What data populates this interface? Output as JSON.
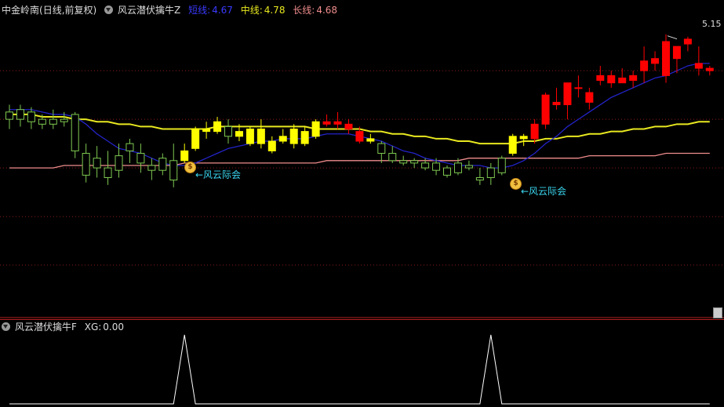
{
  "header": {
    "stock_name": "中金岭南",
    "period_label": "(日线,前复权)",
    "indicator_name": "风云潜伏擒牛Z",
    "short_label": "短线:",
    "short_value": "4.67",
    "mid_label": "中线:",
    "mid_value": "4.78",
    "long_label": "长线:",
    "long_value": "4.68"
  },
  "sub_header": {
    "indicator_name": "风云潜伏擒牛F",
    "xg_label": "XG:",
    "xg_value": "0.00"
  },
  "annotations": [
    {
      "text": "←风云际会",
      "bar": 16
    },
    {
      "text": "←风云际会",
      "bar": 44
    }
  ],
  "max_label": "5.15",
  "colors": {
    "background": "#000000",
    "up_candle": "#ff0000",
    "down_candle": "#7ec850",
    "signal_candle": "#ffff00",
    "short_line": "#2323c8",
    "mid_line": "#e8e820",
    "long_line": "#f08c8c",
    "grid": "#8b1a1a",
    "annotation": "#3ad6f0"
  },
  "chart_data": {
    "type": "candlestick",
    "price_range": [
      4.0,
      5.22
    ],
    "candles": [
      {
        "o": 4.83,
        "h": 4.86,
        "l": 4.76,
        "c": 4.8,
        "k": "down"
      },
      {
        "o": 4.84,
        "h": 4.86,
        "l": 4.77,
        "c": 4.8,
        "k": "down"
      },
      {
        "o": 4.83,
        "h": 4.85,
        "l": 4.76,
        "c": 4.79,
        "k": "down"
      },
      {
        "o": 4.8,
        "h": 4.82,
        "l": 4.76,
        "c": 4.78,
        "k": "down"
      },
      {
        "o": 4.8,
        "h": 4.84,
        "l": 4.76,
        "c": 4.78,
        "k": "down"
      },
      {
        "o": 4.8,
        "h": 4.83,
        "l": 4.77,
        "c": 4.79,
        "k": "down"
      },
      {
        "o": 4.82,
        "h": 4.83,
        "l": 4.64,
        "c": 4.67,
        "k": "down"
      },
      {
        "o": 4.66,
        "h": 4.7,
        "l": 4.54,
        "c": 4.57,
        "k": "down"
      },
      {
        "o": 4.64,
        "h": 4.69,
        "l": 4.56,
        "c": 4.6,
        "k": "down"
      },
      {
        "o": 4.6,
        "h": 4.67,
        "l": 4.53,
        "c": 4.56,
        "k": "down"
      },
      {
        "o": 4.65,
        "h": 4.7,
        "l": 4.56,
        "c": 4.59,
        "k": "down"
      },
      {
        "o": 4.7,
        "h": 4.72,
        "l": 4.62,
        "c": 4.67,
        "k": "down"
      },
      {
        "o": 4.66,
        "h": 4.7,
        "l": 4.58,
        "c": 4.62,
        "k": "down"
      },
      {
        "o": 4.61,
        "h": 4.64,
        "l": 4.55,
        "c": 4.59,
        "k": "down"
      },
      {
        "o": 4.64,
        "h": 4.66,
        "l": 4.57,
        "c": 4.59,
        "k": "down"
      },
      {
        "o": 4.63,
        "h": 4.7,
        "l": 4.52,
        "c": 4.55,
        "k": "down"
      },
      {
        "o": 4.63,
        "h": 4.7,
        "l": 4.62,
        "c": 4.67,
        "k": "signal"
      },
      {
        "o": 4.68,
        "h": 4.77,
        "l": 4.67,
        "c": 4.76,
        "k": "signal"
      },
      {
        "o": 4.75,
        "h": 4.79,
        "l": 4.72,
        "c": 4.76,
        "k": "signal"
      },
      {
        "o": 4.75,
        "h": 4.81,
        "l": 4.74,
        "c": 4.79,
        "k": "signal"
      },
      {
        "o": 4.77,
        "h": 4.8,
        "l": 4.7,
        "c": 4.73,
        "k": "down"
      },
      {
        "o": 4.75,
        "h": 4.78,
        "l": 4.71,
        "c": 4.73,
        "k": "signal"
      },
      {
        "o": 4.7,
        "h": 4.77,
        "l": 4.69,
        "c": 4.76,
        "k": "signal"
      },
      {
        "o": 4.76,
        "h": 4.8,
        "l": 4.68,
        "c": 4.7,
        "k": "signal"
      },
      {
        "o": 4.67,
        "h": 4.73,
        "l": 4.66,
        "c": 4.71,
        "k": "signal"
      },
      {
        "o": 4.71,
        "h": 4.76,
        "l": 4.7,
        "c": 4.73,
        "k": "signal"
      },
      {
        "o": 4.7,
        "h": 4.78,
        "l": 4.68,
        "c": 4.76,
        "k": "signal"
      },
      {
        "o": 4.7,
        "h": 4.77,
        "l": 4.69,
        "c": 4.75,
        "k": "signal"
      },
      {
        "o": 4.73,
        "h": 4.8,
        "l": 4.72,
        "c": 4.79,
        "k": "signal"
      },
      {
        "o": 4.78,
        "h": 4.82,
        "l": 4.77,
        "c": 4.79,
        "k": "up"
      },
      {
        "o": 4.79,
        "h": 4.83,
        "l": 4.76,
        "c": 4.78,
        "k": "up"
      },
      {
        "o": 4.78,
        "h": 4.8,
        "l": 4.74,
        "c": 4.76,
        "k": "up"
      },
      {
        "o": 4.75,
        "h": 4.77,
        "l": 4.7,
        "c": 4.71,
        "k": "up"
      },
      {
        "o": 4.72,
        "h": 4.74,
        "l": 4.7,
        "c": 4.71,
        "k": "signal"
      },
      {
        "o": 4.7,
        "h": 4.71,
        "l": 4.62,
        "c": 4.66,
        "k": "down"
      },
      {
        "o": 4.66,
        "h": 4.69,
        "l": 4.62,
        "c": 4.63,
        "k": "down"
      },
      {
        "o": 4.63,
        "h": 4.65,
        "l": 4.61,
        "c": 4.62,
        "k": "down"
      },
      {
        "o": 4.62,
        "h": 4.64,
        "l": 4.6,
        "c": 4.63,
        "k": "down"
      },
      {
        "o": 4.62,
        "h": 4.64,
        "l": 4.59,
        "c": 4.6,
        "k": "down"
      },
      {
        "o": 4.62,
        "h": 4.64,
        "l": 4.57,
        "c": 4.59,
        "k": "down"
      },
      {
        "o": 4.6,
        "h": 4.61,
        "l": 4.56,
        "c": 4.57,
        "k": "down"
      },
      {
        "o": 4.62,
        "h": 4.64,
        "l": 4.57,
        "c": 4.58,
        "k": "down"
      },
      {
        "o": 4.61,
        "h": 4.63,
        "l": 4.59,
        "c": 4.6,
        "k": "down"
      },
      {
        "o": 4.56,
        "h": 4.6,
        "l": 4.53,
        "c": 4.55,
        "k": "down"
      },
      {
        "o": 4.6,
        "h": 4.62,
        "l": 4.53,
        "c": 4.56,
        "k": "down"
      },
      {
        "o": 4.64,
        "h": 4.65,
        "l": 4.57,
        "c": 4.58,
        "k": "down"
      },
      {
        "o": 4.66,
        "h": 4.74,
        "l": 4.65,
        "c": 4.73,
        "k": "signal"
      },
      {
        "o": 4.73,
        "h": 4.74,
        "l": 4.69,
        "c": 4.72,
        "k": "signal"
      },
      {
        "o": 4.72,
        "h": 4.8,
        "l": 4.7,
        "c": 4.78,
        "k": "up"
      },
      {
        "o": 4.78,
        "h": 4.91,
        "l": 4.76,
        "c": 4.9,
        "k": "up"
      },
      {
        "o": 4.86,
        "h": 4.93,
        "l": 4.84,
        "c": 4.87,
        "k": "up"
      },
      {
        "o": 4.86,
        "h": 4.95,
        "l": 4.8,
        "c": 4.95,
        "k": "up"
      },
      {
        "o": 4.93,
        "h": 4.98,
        "l": 4.89,
        "c": 4.93,
        "k": "up"
      },
      {
        "o": 4.87,
        "h": 4.93,
        "l": 4.84,
        "c": 4.91,
        "k": "up"
      },
      {
        "o": 4.96,
        "h": 5.02,
        "l": 4.94,
        "c": 4.98,
        "k": "up"
      },
      {
        "o": 4.98,
        "h": 5.0,
        "l": 4.93,
        "c": 4.95,
        "k": "up"
      },
      {
        "o": 4.97,
        "h": 5.01,
        "l": 4.95,
        "c": 4.95,
        "k": "up"
      },
      {
        "o": 4.96,
        "h": 5.0,
        "l": 4.93,
        "c": 4.98,
        "k": "up"
      },
      {
        "o": 5.0,
        "h": 5.1,
        "l": 4.95,
        "c": 5.04,
        "k": "up"
      },
      {
        "o": 5.03,
        "h": 5.08,
        "l": 5.0,
        "c": 5.05,
        "k": "up"
      },
      {
        "o": 4.98,
        "h": 5.15,
        "l": 4.95,
        "c": 5.12,
        "k": "up"
      },
      {
        "o": 5.05,
        "h": 5.1,
        "l": 4.99,
        "c": 5.1,
        "k": "up"
      },
      {
        "o": 5.11,
        "h": 5.14,
        "l": 5.08,
        "c": 5.13,
        "k": "up"
      },
      {
        "o": 5.03,
        "h": 5.1,
        "l": 4.98,
        "c": 5.01,
        "k": "up"
      },
      {
        "o": 5.01,
        "h": 5.02,
        "l": 4.98,
        "c": 5.0,
        "k": "up"
      }
    ],
    "short_line": [
      4.84,
      4.84,
      4.84,
      4.83,
      4.82,
      4.82,
      4.81,
      4.78,
      4.74,
      4.71,
      4.68,
      4.67,
      4.66,
      4.64,
      4.62,
      4.61,
      4.61,
      4.62,
      4.64,
      4.66,
      4.68,
      4.69,
      4.7,
      4.71,
      4.71,
      4.72,
      4.72,
      4.72,
      4.73,
      4.74,
      4.74,
      4.74,
      4.73,
      4.72,
      4.71,
      4.69,
      4.67,
      4.66,
      4.64,
      4.63,
      4.62,
      4.61,
      4.61,
      4.61,
      4.6,
      4.6,
      4.61,
      4.63,
      4.66,
      4.7,
      4.73,
      4.77,
      4.8,
      4.83,
      4.86,
      4.89,
      4.91,
      4.93,
      4.95,
      4.97,
      4.98,
      5.0,
      5.02,
      5.03,
      5.03
    ],
    "mid_line": [
      4.82,
      4.82,
      4.82,
      4.81,
      4.81,
      4.81,
      4.8,
      4.8,
      4.79,
      4.79,
      4.78,
      4.78,
      4.77,
      4.77,
      4.76,
      4.76,
      4.76,
      4.76,
      4.76,
      4.77,
      4.77,
      4.77,
      4.77,
      4.77,
      4.77,
      4.77,
      4.77,
      4.77,
      4.76,
      4.76,
      4.76,
      4.76,
      4.76,
      4.75,
      4.75,
      4.74,
      4.74,
      4.73,
      4.73,
      4.72,
      4.72,
      4.71,
      4.71,
      4.7,
      4.7,
      4.7,
      4.7,
      4.71,
      4.71,
      4.72,
      4.72,
      4.73,
      4.73,
      4.74,
      4.74,
      4.75,
      4.75,
      4.76,
      4.76,
      4.77,
      4.77,
      4.78,
      4.78,
      4.79,
      4.79
    ],
    "long_line": [
      4.6,
      4.6,
      4.6,
      4.6,
      4.6,
      4.61,
      4.61,
      4.61,
      4.61,
      4.61,
      4.61,
      4.61,
      4.61,
      4.61,
      4.61,
      4.61,
      4.62,
      4.62,
      4.62,
      4.62,
      4.62,
      4.62,
      4.62,
      4.62,
      4.62,
      4.62,
      4.62,
      4.62,
      4.62,
      4.63,
      4.63,
      4.63,
      4.63,
      4.63,
      4.63,
      4.63,
      4.63,
      4.63,
      4.63,
      4.63,
      4.63,
      4.63,
      4.64,
      4.64,
      4.64,
      4.64,
      4.64,
      4.64,
      4.64,
      4.64,
      4.64,
      4.64,
      4.64,
      4.65,
      4.65,
      4.65,
      4.65,
      4.65,
      4.65,
      4.65,
      4.66,
      4.66,
      4.66,
      4.66,
      4.66
    ],
    "xg_signals": [
      0,
      0,
      0,
      0,
      0,
      0,
      0,
      0,
      0,
      0,
      0,
      0,
      0,
      0,
      0,
      0,
      1,
      0,
      0,
      0,
      0,
      0,
      0,
      0,
      0,
      0,
      0,
      0,
      0,
      0,
      0,
      0,
      0,
      0,
      0,
      0,
      0,
      0,
      0,
      0,
      0,
      0,
      0,
      0,
      1,
      0,
      0,
      0,
      0,
      0,
      0,
      0,
      0,
      0,
      0,
      0,
      0,
      0,
      0,
      0,
      0,
      0,
      0,
      0,
      0
    ]
  }
}
